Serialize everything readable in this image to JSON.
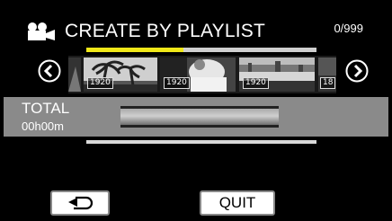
{
  "header": {
    "title": "CREATE BY PLAYLIST",
    "counter": "0/999",
    "icon": "movie-camera-icon"
  },
  "progress": {
    "fraction": 0.42,
    "color": "#f0e818"
  },
  "thumbnails": [
    {
      "label": "1920",
      "scene": "palm-trees"
    },
    {
      "label": "1920",
      "scene": "person-white"
    },
    {
      "label": "1920",
      "scene": "waterfront"
    },
    {
      "label": "18",
      "scene": "partial"
    }
  ],
  "nav": {
    "prev_icon": "chevron-left-icon",
    "next_icon": "chevron-right-icon"
  },
  "total": {
    "label": "TOTAL",
    "time": "00h00m"
  },
  "buttons": {
    "back_icon": "return-arrow-icon",
    "quit": "QUIT"
  }
}
